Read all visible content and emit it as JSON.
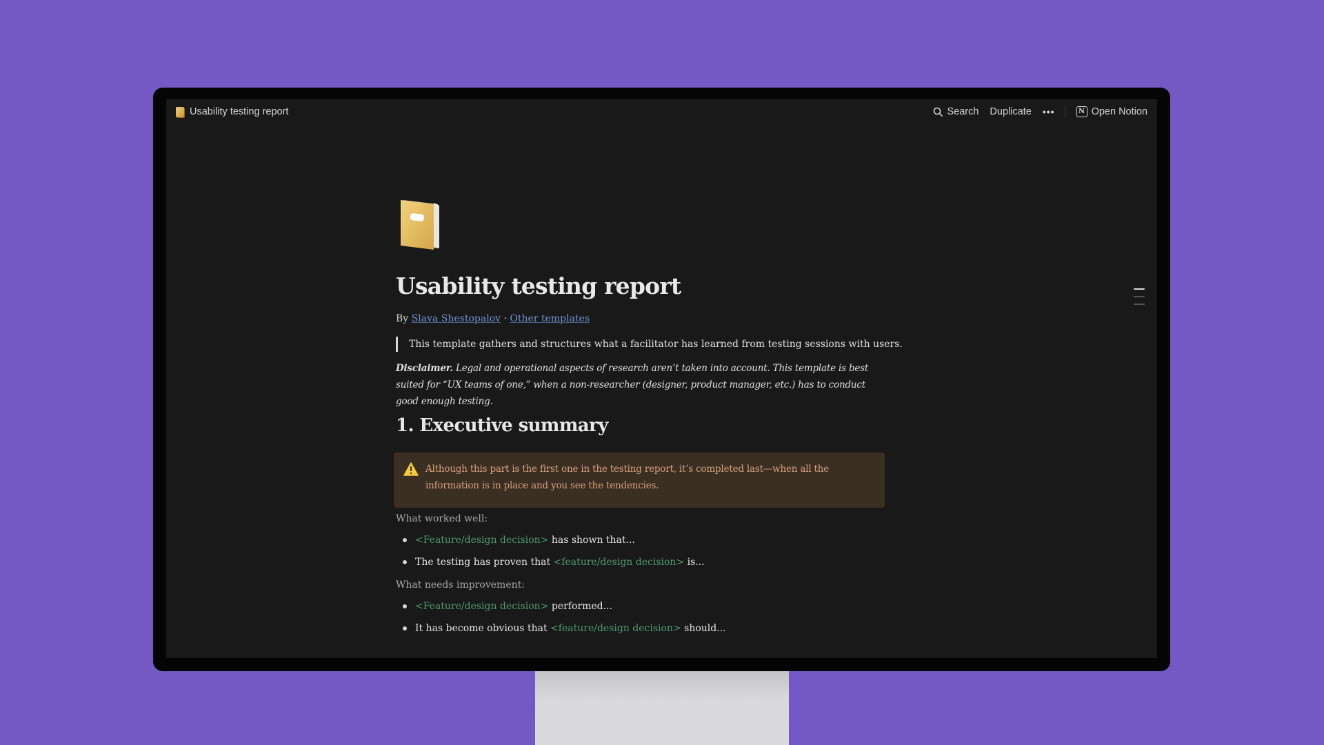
{
  "window": {
    "breadcrumb_title": "Usability testing report",
    "actions": {
      "search_label": "Search",
      "duplicate_label": "Duplicate",
      "more_label": "•••",
      "open_notion_label": "Open Notion"
    }
  },
  "page": {
    "icon": "notebook-icon",
    "title": "Usability testing report",
    "byline": {
      "prefix": "By",
      "author": "Slava Shestopalov",
      "separator": "·",
      "other_link": "Other templates"
    },
    "quote": "This template gathers and structures what a facilitator has learned from testing sessions with users.",
    "disclaimer": {
      "lead": "Disclaimer.",
      "text": " Legal and operational aspects of research aren’t taken into account. This template is best suited for “UX teams of one,” when a non-researcher (designer, product manager, etc.) has to conduct good enough testing."
    },
    "section_heading": "1. Executive summary",
    "callout": {
      "icon": "warning-icon",
      "text": "Although this part is the first one in the testing report, it’s completed last—when all the information is in place and you see the tendencies."
    },
    "worked_well": {
      "label": "What worked well:",
      "items": [
        {
          "before": "",
          "placeholder": "<Feature/design decision>",
          "after": " has shown that..."
        },
        {
          "before": "The testing has proven that ",
          "placeholder": "<feature/design decision>",
          "after": " is..."
        }
      ]
    },
    "needs_improvement": {
      "label": "What needs improvement:",
      "items": [
        {
          "before": "",
          "placeholder": "<Feature/design decision>",
          "after": " performed..."
        },
        {
          "before": "It has become obvious that ",
          "placeholder": "<feature/design decision>",
          "after": " should..."
        }
      ]
    }
  },
  "colors": {
    "background": "#7459c4",
    "screen": "#191919",
    "link": "#6f93d6",
    "placeholder": "#4f9b6d",
    "callout_bg": "#3b2e22",
    "callout_text": "#d6a07e"
  }
}
